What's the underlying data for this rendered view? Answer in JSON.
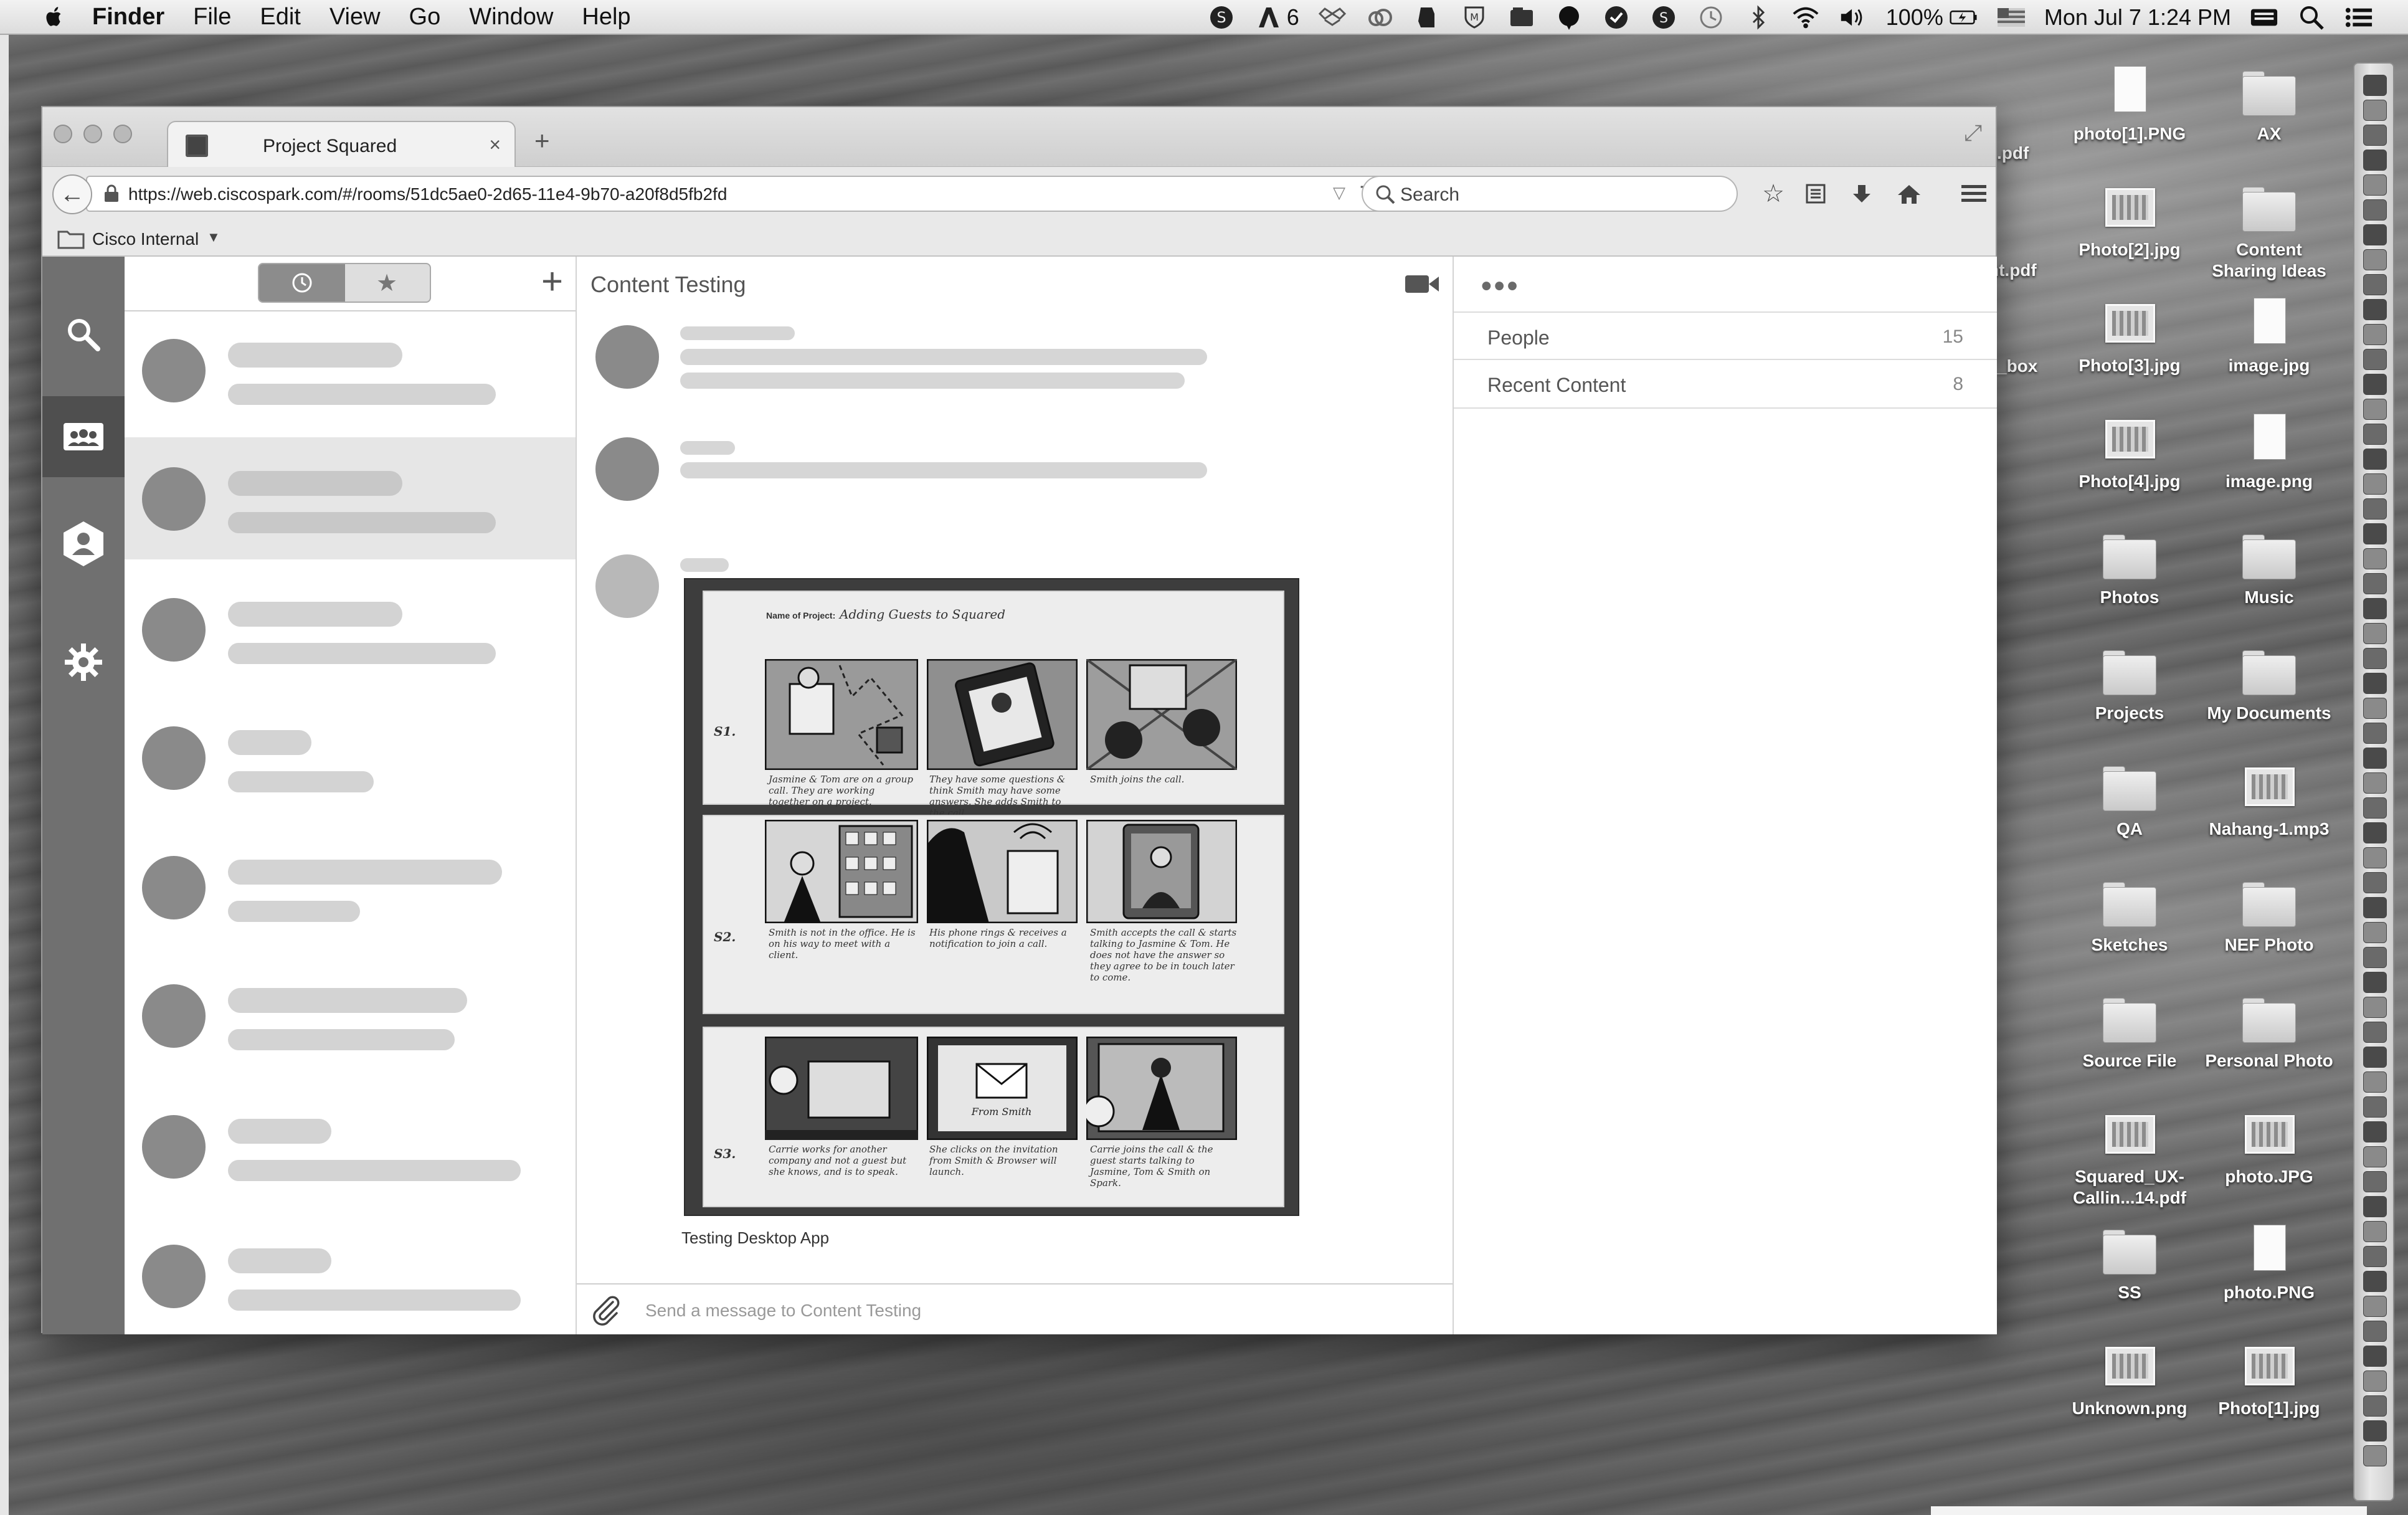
{
  "menubar": {
    "app_name": "Finder",
    "menus": [
      "File",
      "Edit",
      "View",
      "Go",
      "Window",
      "Help"
    ],
    "adobe_badge": "6",
    "battery": "100%",
    "clock": "Mon Jul 7  1:24 PM"
  },
  "browser": {
    "tab_title": "Project Squared",
    "tab_close": "×",
    "new_tab": "+",
    "url": "https://web.ciscospark.com/#/rooms/51dc5ae0-2d65-11e4-9b70-a20f8d5fb2fd",
    "search_placeholder": "Search",
    "bookmark_folder": "Cisco Internal"
  },
  "app": {
    "rail_items": [
      "search-icon",
      "rooms-icon",
      "contacts-icon",
      "gear-icon"
    ],
    "conversation_add": "+",
    "chat_title": "Content Testing",
    "image_caption": "Testing Desktop App",
    "composer_placeholder": "Send a message to Content Testing",
    "details_menu": "•••",
    "details": [
      {
        "label": "People",
        "count": "15"
      },
      {
        "label": "Recent Content",
        "count": "8"
      }
    ]
  },
  "storyboard": {
    "project_label": "Name of Project:",
    "project_name": "Adding Guests to Squared",
    "rows": [
      "S1.",
      "S2.",
      "S3."
    ],
    "captions": [
      [
        "Jasmine & Tom are on a group call. They are working together on a project.",
        "They have some questions & think Smith may have some answers. She adds Smith to the call.",
        "Smith joins the call."
      ],
      [
        "Smith is not in the office. He is on his way to meet with a client.",
        "His phone rings & receives a notification to join a call.",
        "Smith accepts the call & starts talking to Jasmine & Tom. He does not have the answer so they agree to be in touch later to come."
      ],
      [
        "Carrie works for another company and not a guest but she knows, and is to speak.",
        "She clicks on the invitation from Smith & Browser will launch.",
        "Carrie joins the call & the guest starts talking to Jasmine, Tom & Smith on Spark."
      ]
    ],
    "envelope_text": "From Smith"
  },
  "desktop": {
    "icons": [
      {
        "label": "photo[1].PNG",
        "kind": "file"
      },
      {
        "label": "AX",
        "kind": "folder"
      },
      {
        "label": "Photo[2].jpg",
        "kind": "image"
      },
      {
        "label": "Content Sharing Ideas",
        "kind": "folder"
      },
      {
        "label": "Photo[3].jpg",
        "kind": "image"
      },
      {
        "label": "image.jpg",
        "kind": "file"
      },
      {
        "label": "Photo[4].jpg",
        "kind": "image"
      },
      {
        "label": "image.png",
        "kind": "file"
      },
      {
        "label": "Photos",
        "kind": "folder"
      },
      {
        "label": "Music",
        "kind": "folder"
      },
      {
        "label": "Projects",
        "kind": "folder"
      },
      {
        "label": "My Documents",
        "kind": "folder"
      },
      {
        "label": "QA",
        "kind": "folder"
      },
      {
        "label": "Nahang-1.mp3",
        "kind": "image"
      },
      {
        "label": "Sketches",
        "kind": "folder"
      },
      {
        "label": "NEF Photo",
        "kind": "folder"
      },
      {
        "label": "Source File",
        "kind": "folder"
      },
      {
        "label": "Personal Photo",
        "kind": "folder"
      },
      {
        "label": "Squared_UX-Callin...14.pdf",
        "kind": "image"
      },
      {
        "label": "photo.JPG",
        "kind": "image"
      },
      {
        "label": "SS",
        "kind": "folder"
      },
      {
        "label": "photo.PNG",
        "kind": "file"
      },
      {
        "label": "Unknown.png",
        "kind": "image"
      },
      {
        "label": "Photo[1].jpg",
        "kind": "image"
      }
    ],
    "partial_labels": [
      ".pdf",
      "nt.pdf",
      "_box"
    ]
  }
}
